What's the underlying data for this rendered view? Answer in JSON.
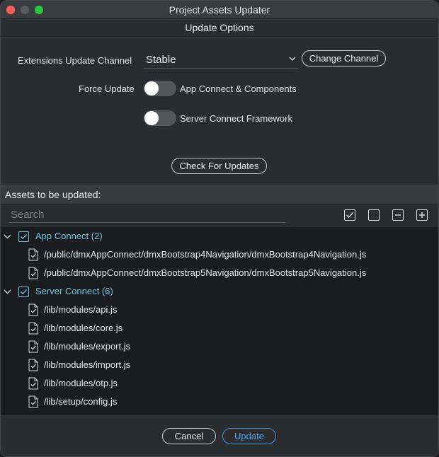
{
  "window": {
    "title": "Project Assets Updater"
  },
  "header": {
    "title": "Update Options"
  },
  "options": {
    "channel_label": "Extensions Update Channel",
    "channel_value": "Stable",
    "change_channel_label": "Change Channel",
    "force_update_label": "Force Update",
    "toggles": [
      {
        "label": "App Connect & Components",
        "on": false
      },
      {
        "label": "Server Connect Framework",
        "on": false
      }
    ],
    "check_updates_label": "Check For Updates"
  },
  "assets": {
    "title": "Assets to be updated:",
    "search_placeholder": "Search",
    "groups": [
      {
        "label": "App Connect (2)",
        "checked": true,
        "files": [
          "/public/dmxAppConnect/dmxBootstrap4Navigation/dmxBootstrap4Navigation.js",
          "/public/dmxAppConnect/dmxBootstrap5Navigation/dmxBootstrap5Navigation.js"
        ]
      },
      {
        "label": "Server Connect (6)",
        "checked": true,
        "files": [
          "/lib/modules/api.js",
          "/lib/modules/core.js",
          "/lib/modules/export.js",
          "/lib/modules/import.js",
          "/lib/modules/otp.js",
          "/lib/setup/config.js"
        ]
      }
    ]
  },
  "footer": {
    "cancel_label": "Cancel",
    "update_label": "Update"
  },
  "colors": {
    "accent": "#3d8fd6",
    "group_text": "#6ec3dd",
    "window_bg": "#2b2c30",
    "tree_bg": "#1b1c1f"
  }
}
